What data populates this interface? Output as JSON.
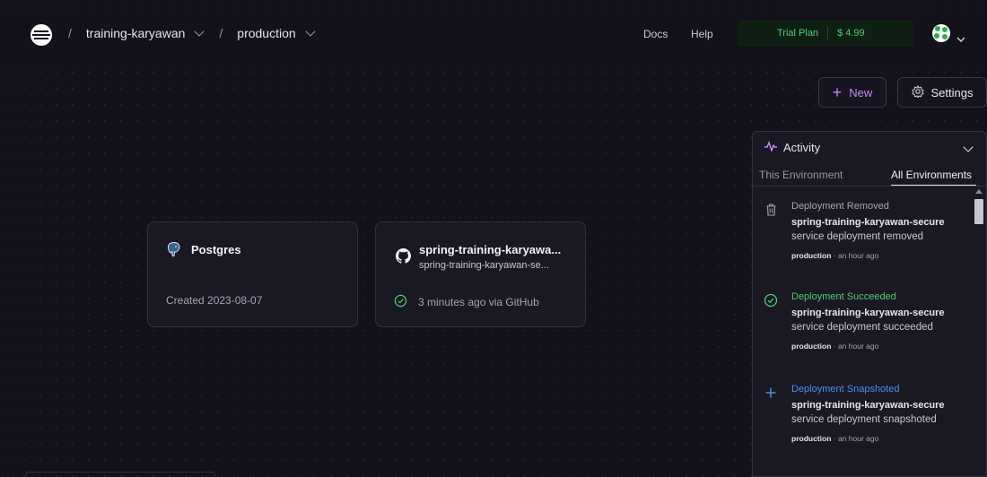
{
  "header": {
    "project": "training-karyawan",
    "environment": "production",
    "separator": "/",
    "links": {
      "docs": "Docs",
      "help": "Help"
    },
    "plan": {
      "label": "Trial Plan",
      "price": "$ 4.99"
    }
  },
  "toolbar": {
    "new_label": "New",
    "settings_label": "Settings"
  },
  "cards": [
    {
      "title": "Postgres",
      "footer": "Created 2023-08-07",
      "icon": "postgres-icon"
    },
    {
      "title": "spring-training-karyawa...",
      "subtitle": "spring-training-karyawan-se...",
      "footer": "3 minutes ago via GitHub",
      "icon": "github-icon"
    }
  ],
  "activity": {
    "title": "Activity",
    "tabs": [
      "This Environment",
      "All Environments"
    ],
    "active_tab": "All Environments",
    "items": [
      {
        "title": "Deployment Removed",
        "service": "spring-training-karyawan-secure",
        "desc": "service deployment removed",
        "env": "production",
        "time": "· an hour ago",
        "color": "#a8a5b4",
        "icon": "trash-icon"
      },
      {
        "title": "Deployment Succeeded",
        "service": "spring-training-karyawan-secure",
        "desc": "service deployment succeeded",
        "env": "production",
        "time": "· an hour ago",
        "color": "#4fcf73",
        "icon": "check-circle-icon"
      },
      {
        "title": "Deployment Snapshoted",
        "service": "spring-training-karyawan-secure",
        "desc": "service deployment snapshoted",
        "env": "production",
        "time": "· an hour ago",
        "color": "#4a8ff0",
        "icon": "plus-icon"
      }
    ]
  },
  "colors": {
    "background": "#13111c",
    "accent_purple": "#c48bf5",
    "success": "#4fcf73",
    "info": "#4a8ff0"
  }
}
